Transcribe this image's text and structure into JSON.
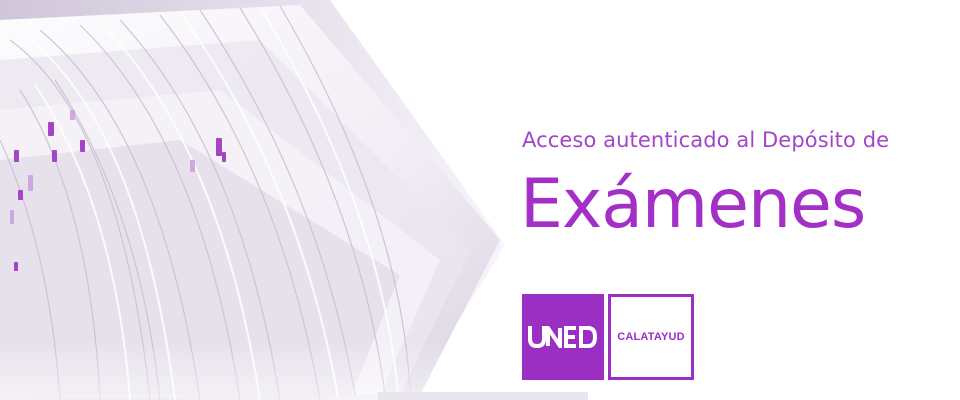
{
  "banner": {
    "subtitle": "Acceso autenticado al Depósito de",
    "title": "Exámenes",
    "logos": {
      "institution": "UNED",
      "center": "CALATAYUD"
    },
    "colors": {
      "accent": "#a32fc7",
      "subtitle": "#a245c6",
      "logo_bg": "#9b2fc4"
    },
    "image": "stacked-papers-illustration"
  }
}
